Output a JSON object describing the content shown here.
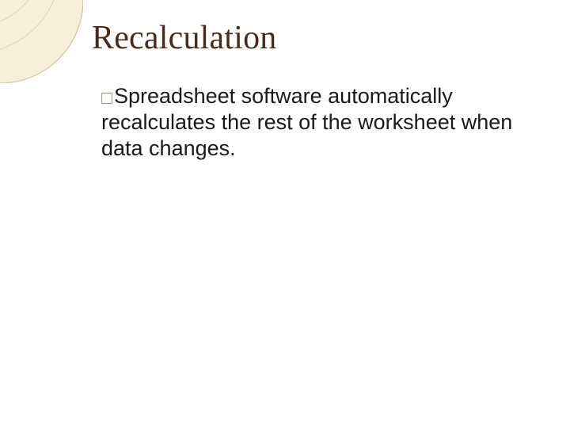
{
  "title": "Recalculation",
  "body": "Spreadsheet software automatically recalculates the rest of the worksheet when data changes."
}
